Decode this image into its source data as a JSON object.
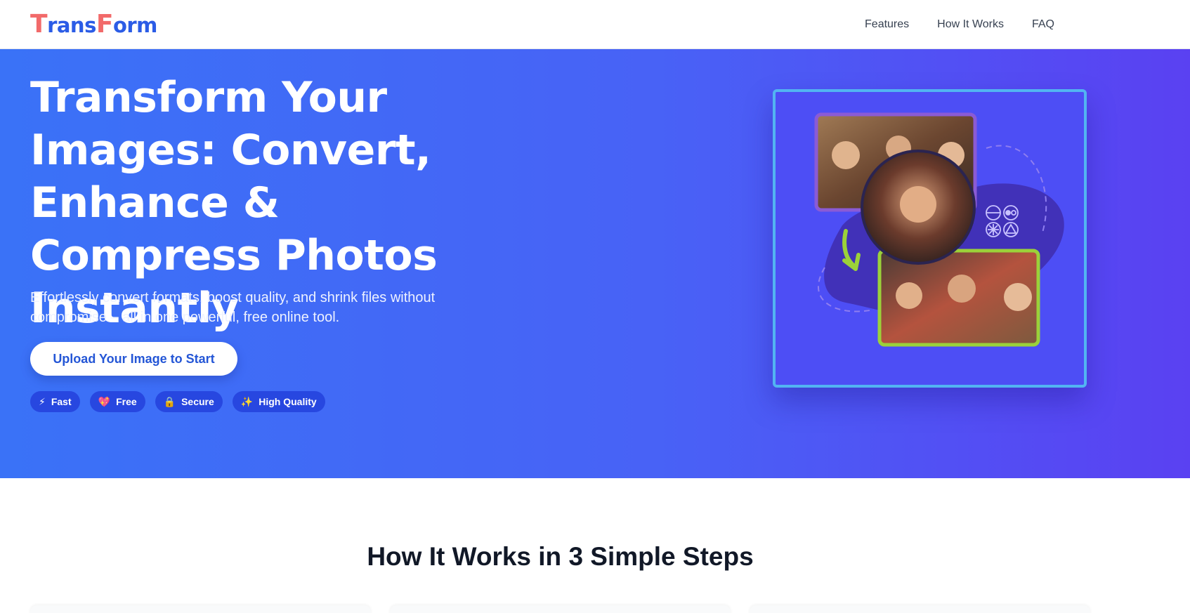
{
  "header": {
    "logo": {
      "part1_cap": "T",
      "part1_rest": "rans",
      "part2_cap": "F",
      "part2_rest": "orm"
    },
    "nav": [
      "Features",
      "How It Works",
      "FAQ"
    ]
  },
  "hero": {
    "title": "Transform Your Images: Convert, Enhance & Compress Photos Instantly",
    "subtitle": "Effortlessly convert formats, boost quality, and shrink files without compromise – all in one powerful, free online tool.",
    "cta_label": "Upload Your Image to Start",
    "badges": [
      {
        "icon": "⚡",
        "icon_name": "lightning-icon",
        "label": "Fast"
      },
      {
        "icon": "💖",
        "icon_name": "heart-icon",
        "label": "Free"
      },
      {
        "icon": "🔒",
        "icon_name": "lock-icon",
        "label": "Secure"
      },
      {
        "icon": "✨",
        "icon_name": "sparkles-icon",
        "label": "High Quality"
      }
    ]
  },
  "how_it_works": {
    "title": "How It Works in 3 Simple Steps"
  },
  "colors": {
    "brand_red": "#f26a6a",
    "brand_blue": "#2b5ce6",
    "hero_gradient_start": "#3a72f7",
    "hero_gradient_end": "#5a41f2",
    "badge_bg": "#2747e0",
    "illustration_border": "#52b4f2",
    "photo_frame_purple": "#8a5bd6",
    "photo_frame_green": "#9bd13a"
  }
}
